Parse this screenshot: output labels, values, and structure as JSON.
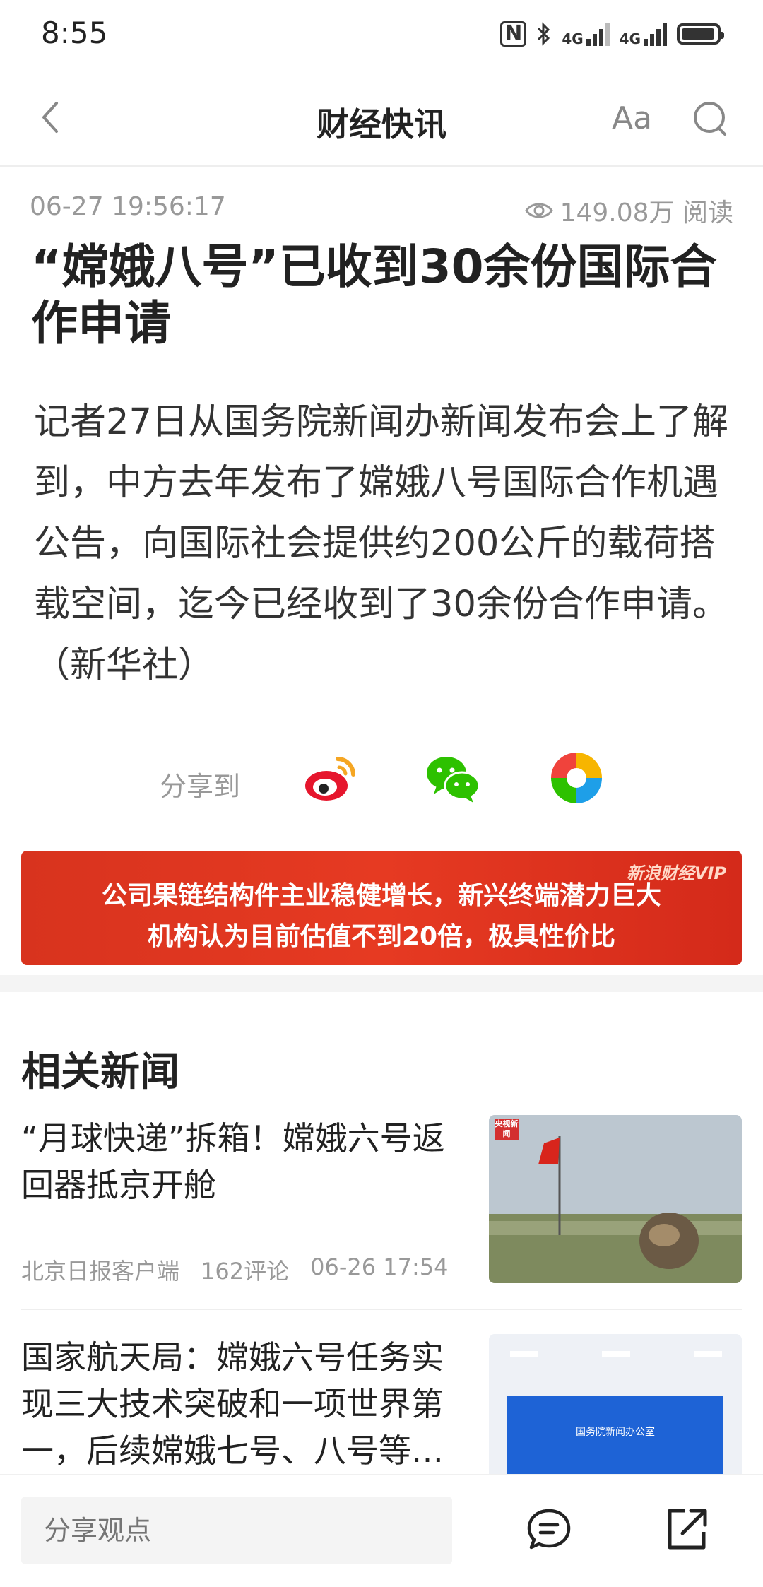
{
  "status_bar": {
    "time": "8:55",
    "network1": "4G",
    "network2": "4G"
  },
  "nav": {
    "title": "财经快讯",
    "font_button": "Aa"
  },
  "article": {
    "datetime": "06-27 19:56:17",
    "views": "149.08万 阅读",
    "title": "“嫦娥八号”已收到30余份国际合作申请",
    "body": "记者27日从国务院新闻办新闻发布会上了解到，中方去年发布了嫦娥八号国际合作机遇公告，向国际社会提供约200公斤的载荷搭载空间，迄今已经收到了30余份合作申请。（新华社）"
  },
  "share": {
    "label": "分享到"
  },
  "ad": {
    "line1": "公司果链结构件主业稳健增长，新兴终端潜力巨大",
    "line2": "机构认为目前估值不到20倍，极具性价比",
    "brand": "新浪财经VIP"
  },
  "related": {
    "title": "相关新闻",
    "items": [
      {
        "title": "“月球快递”拆箱！嫦娥六号返回器抵京开舱",
        "source": "北京日报客户端",
        "comments": "162评论",
        "time": "06-26 17:54",
        "thumb_badge": "央视新闻"
      },
      {
        "title": "国家航天局：嫦娥六号任务实现三大技术突破和一项世界第一，后续嫦娥七号、八号等…",
        "thumb_text": "国务院新闻办公室"
      }
    ]
  },
  "bottom_bar": {
    "comment_placeholder": "分享观点"
  },
  "colors": {
    "ad_red": "#e03a22",
    "weibo_red": "#e6162d",
    "wechat_green": "#2dc100"
  }
}
